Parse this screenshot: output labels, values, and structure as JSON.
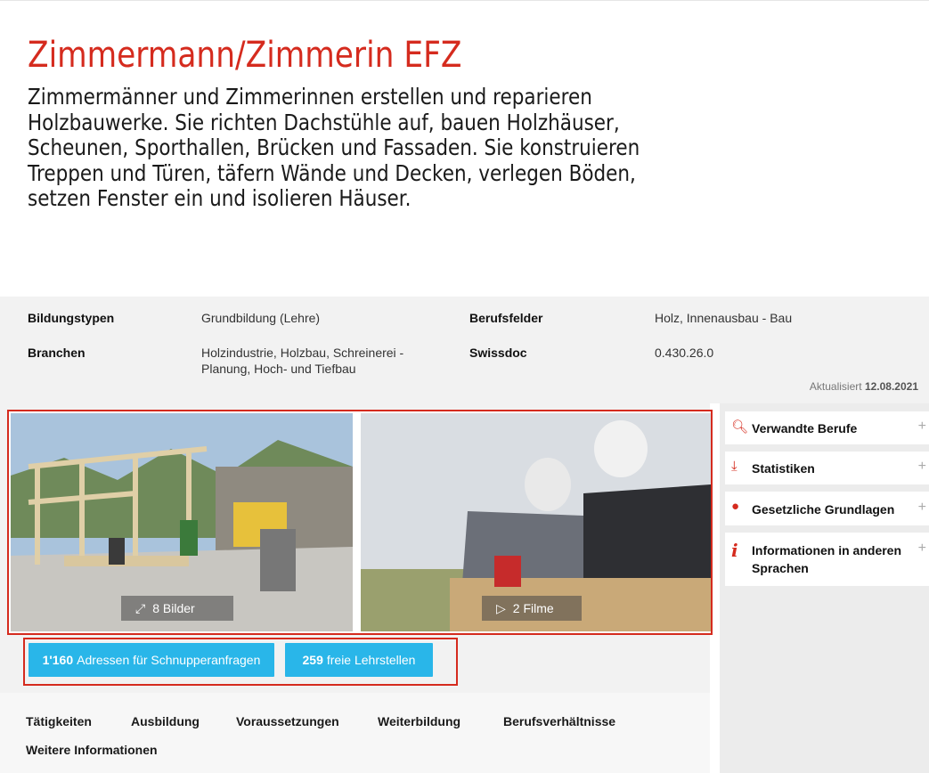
{
  "hero": {
    "title": "Zimmermann/Zimmerin EFZ",
    "description_lines": [
      "Zimmermänner und Zimmerinnen erstellen und reparieren",
      "Holzbauwerke. Sie richten Dachstühle auf, bauen Holzhäuser,",
      "Scheunen, Sporthallen, Brücken und Fassaden. Sie konstruieren",
      "Treppen und Türen, täfern Wände und Decken, verlegen Böden,",
      "setzen Fenster ein und isolieren Häuser."
    ]
  },
  "meta": {
    "bildungstypen_label": "Bildungstypen",
    "bildungstypen_value": "Grundbildung (Lehre)",
    "branchen_label": "Branchen",
    "branchen_value_line1": "Holzindustrie, Holzbau, Schreinerei -",
    "branchen_value_line2": "Planung, Hoch- und Tiefbau",
    "berufsfelder_label": "Berufsfelder",
    "berufsfelder_value": "Holz, Innenausbau - Bau",
    "swissdoc_label": "Swissdoc",
    "swissdoc_value": "0.430.26.0",
    "updated_prefix": "Aktualisiert",
    "updated_date": "12.08.2021"
  },
  "gallery": {
    "images_label": "8 Bilder",
    "films_label": "2 Filme"
  },
  "buttons": {
    "schnupper_count": "1'160",
    "schnupper_label": "Adressen für Schnupperanfragen",
    "lehrstellen_count": "259",
    "lehrstellen_label": "freie Lehrstellen"
  },
  "nav": {
    "items": [
      "Tätigkeiten",
      "Ausbildung",
      "Voraussetzungen",
      "Weiterbildung",
      "Berufsverhältnisse",
      "Weitere Informationen"
    ]
  },
  "sidebar": {
    "items": [
      {
        "label": "Verwandte Berufe",
        "icon": "search-icon"
      },
      {
        "label": "Statistiken",
        "icon": "download-icon"
      },
      {
        "label": "Gesetzliche Grundlagen",
        "icon": "globe-icon"
      },
      {
        "label_line1": "Informationen in anderen",
        "label_line2": "Sprachen",
        "icon": "info-icon"
      }
    ],
    "expand_symbol": "+"
  },
  "colors": {
    "brand_red": "#d52b1e",
    "button_blue": "#29b6e9"
  }
}
